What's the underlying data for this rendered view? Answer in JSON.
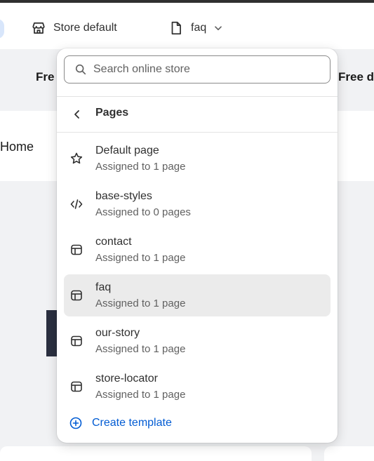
{
  "topbar": {
    "store_label": "Store default",
    "page_label": "faq",
    "store_icon": "store-icon",
    "page_icon": "page-icon"
  },
  "background": {
    "announcement_left": "Fre",
    "announcement_right": "Free d",
    "nav_home": "Home"
  },
  "popover": {
    "search_placeholder": "Search online store",
    "section_title": "Pages",
    "items": [
      {
        "title": "Default page",
        "subtitle": "Assigned to 1 page",
        "icon": "star-icon",
        "selected": false
      },
      {
        "title": "base-styles",
        "subtitle": "Assigned to 0 pages",
        "icon": "code-icon",
        "selected": false
      },
      {
        "title": "contact",
        "subtitle": "Assigned to 1 page",
        "icon": "template-icon",
        "selected": false
      },
      {
        "title": "faq",
        "subtitle": "Assigned to 1 page",
        "icon": "template-icon",
        "selected": true
      },
      {
        "title": "our-story",
        "subtitle": "Assigned to 1 page",
        "icon": "template-icon",
        "selected": false
      },
      {
        "title": "store-locator",
        "subtitle": "Assigned to 1 page",
        "icon": "template-icon",
        "selected": false
      }
    ],
    "create_label": "Create template"
  },
  "colors": {
    "accent": "#005bd3",
    "selected_bg": "#ebebeb",
    "text": "#303030",
    "subtext": "#616161"
  }
}
